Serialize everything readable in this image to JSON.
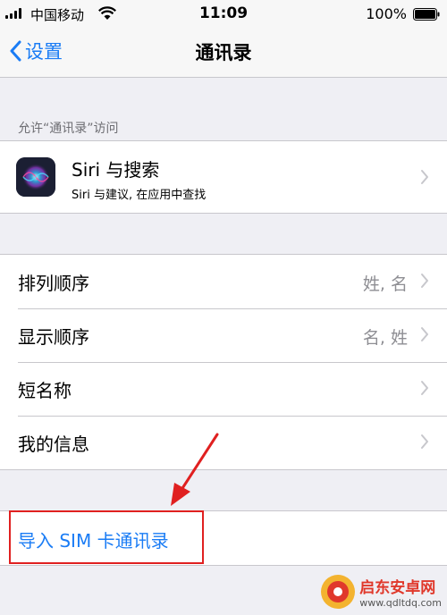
{
  "status_bar": {
    "carrier": "中国移动",
    "time": "11:09",
    "battery_percent": "100%"
  },
  "nav": {
    "back_label": "设置",
    "title": "通讯录"
  },
  "access_section": {
    "header": "允许“通讯录”访问",
    "siri": {
      "title": "Siri 与搜索",
      "subtitle": "Siri 与建议, 在应用中查找"
    }
  },
  "settings_list": [
    {
      "label": "排列顺序",
      "value": "姓, 名"
    },
    {
      "label": "显示顺序",
      "value": "名, 姓"
    },
    {
      "label": "短名称",
      "value": ""
    },
    {
      "label": "我的信息",
      "value": ""
    }
  ],
  "import_action": {
    "label": "导入 SIM 卡通讯录"
  },
  "watermark": {
    "name": "启东安卓网",
    "url": "www.qdltdq.com"
  },
  "colors": {
    "accent": "#1a7cf5",
    "background": "#efeff4",
    "annotation": "#e02020"
  }
}
